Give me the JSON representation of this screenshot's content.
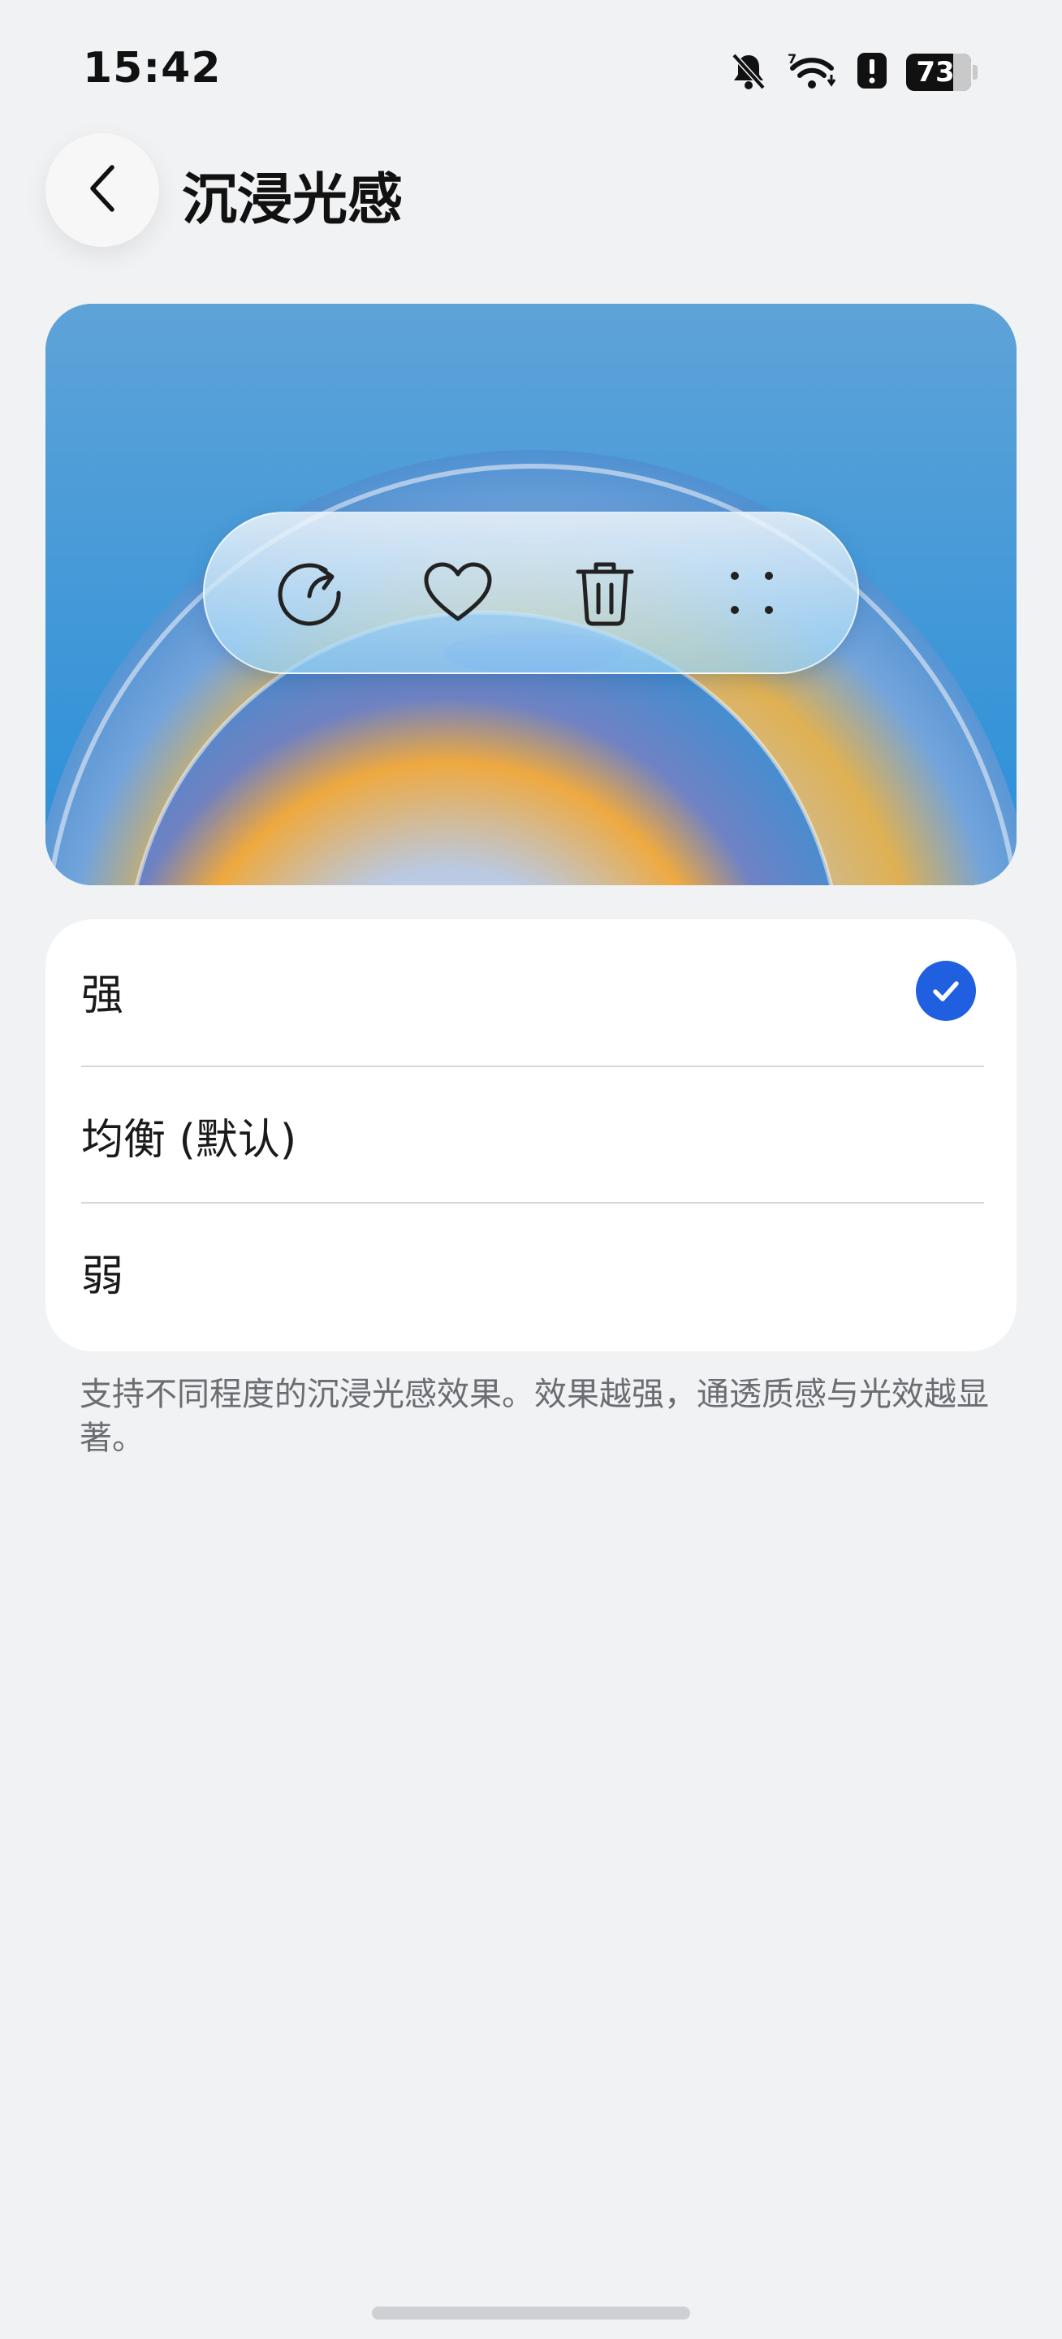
{
  "status": {
    "time": "15:42",
    "battery": "73",
    "icons": [
      "bell-muted-icon",
      "wifi-icon",
      "alert-icon",
      "battery-icon"
    ]
  },
  "header": {
    "title": "沉浸光感",
    "back_icon": "chevron-left-icon"
  },
  "preview": {
    "icons": [
      "share-icon",
      "heart-icon",
      "trash-icon",
      "more-dots-icon"
    ]
  },
  "options": [
    {
      "label": "强",
      "selected": true
    },
    {
      "label": "均衡 (默认)",
      "selected": false
    },
    {
      "label": "弱",
      "selected": false
    }
  ],
  "description": "支持不同程度的沉浸光感效果。效果越强，通透质感与光效越显著。",
  "colors": {
    "accent": "#1f5fe0",
    "background": "#f1f2f4",
    "card": "#ffffff"
  }
}
